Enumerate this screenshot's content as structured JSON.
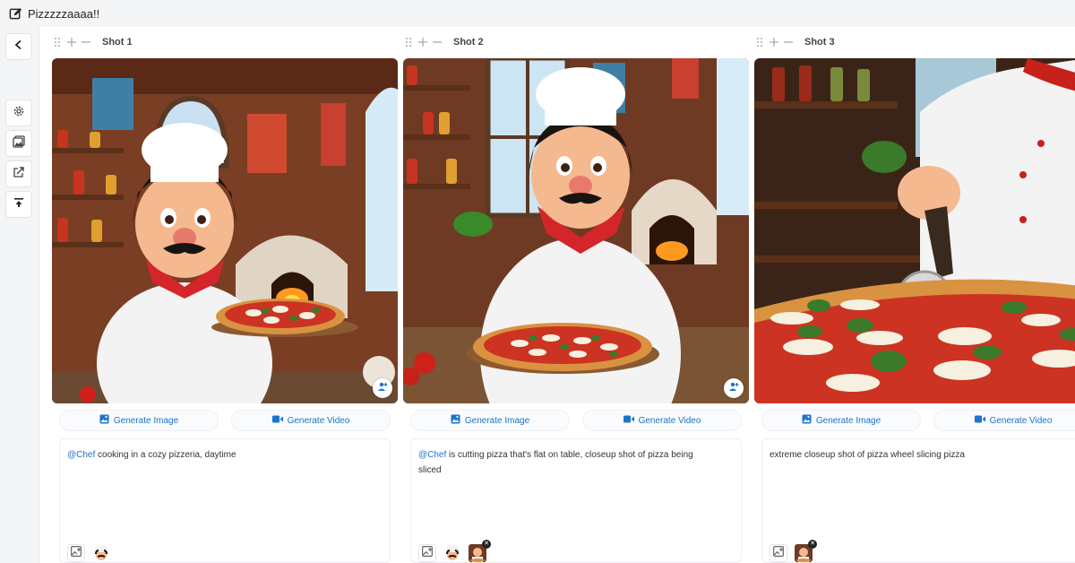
{
  "header": {
    "title": "Pizzzzzaaaa!!"
  },
  "sidebar": {
    "items": [
      {
        "icon": "chevron-left-icon"
      },
      {
        "icon": "gear-icon"
      },
      {
        "icon": "gallery-icon"
      },
      {
        "icon": "export-icon"
      },
      {
        "icon": "upload-icon"
      }
    ]
  },
  "shots": [
    {
      "label": "Shot 1",
      "generate_image_label": "Generate Image",
      "generate_video_label": "Generate Video",
      "prompt_mention": "@Chef",
      "prompt_text": " cooking in a cozy pizzeria, daytime"
    },
    {
      "label": "Shot 2",
      "generate_image_label": "Generate Image",
      "generate_video_label": "Generate Video",
      "prompt_mention": "@Chef",
      "prompt_text": " is cutting pizza that's flat on table, closeup shot of pizza being sliced"
    },
    {
      "label": "Shot 3",
      "generate_image_label": "Generate Image",
      "generate_video_label": "Generate Video",
      "prompt_mention": "",
      "prompt_text": "extreme closeup shot of pizza wheel slicing pizza"
    }
  ],
  "colors": {
    "accent": "#1c74cc",
    "background": "#f4f5f7"
  }
}
